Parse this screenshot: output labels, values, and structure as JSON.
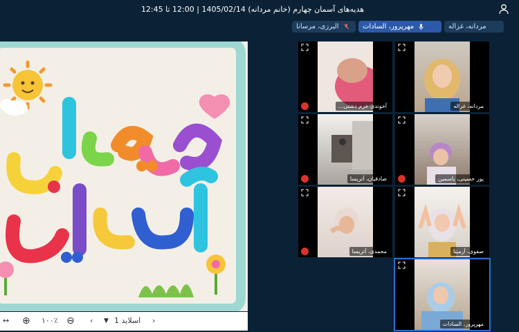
{
  "title": "هدیه‌های آسمان چهارم (خانم مردانه) 1405/02/14 | 12:00 تا 12:45",
  "speakers": [
    {
      "label": "مردانه، غزاله",
      "icon": "user-icon"
    },
    {
      "label": "مهرپرور، السادات",
      "icon": "mic-icon"
    },
    {
      "label": "البرزی، مرسانا",
      "icon": "mic-off-icon"
    }
  ],
  "slide": {
    "line1": "هدیه‌های",
    "line2": "آسمانی"
  },
  "toolbar": {
    "slide_label": "اسلاید 1",
    "zoom": "۱۰۰٪"
  },
  "participants": [
    {
      "name": "مردانه، غزاله",
      "muted": false,
      "active": false
    },
    {
      "name": "آخوندی خرم دشتی...",
      "muted": true,
      "active": false
    },
    {
      "name": "پور حسینی، یاسمین",
      "muted": true,
      "active": false
    },
    {
      "name": "صادقیان، آتریسا",
      "muted": true,
      "active": false
    },
    {
      "name": "صفوی، آرمیتا",
      "muted": false,
      "active": false
    },
    {
      "name": "محمدی، آتریسا",
      "muted": true,
      "active": false
    },
    {
      "name": "مهرپرور، السادات",
      "muted": false,
      "active": true
    }
  ],
  "colors": {
    "mute": "#d9342b",
    "active_border": "#2a6fd6",
    "bg": "#0b2236"
  }
}
